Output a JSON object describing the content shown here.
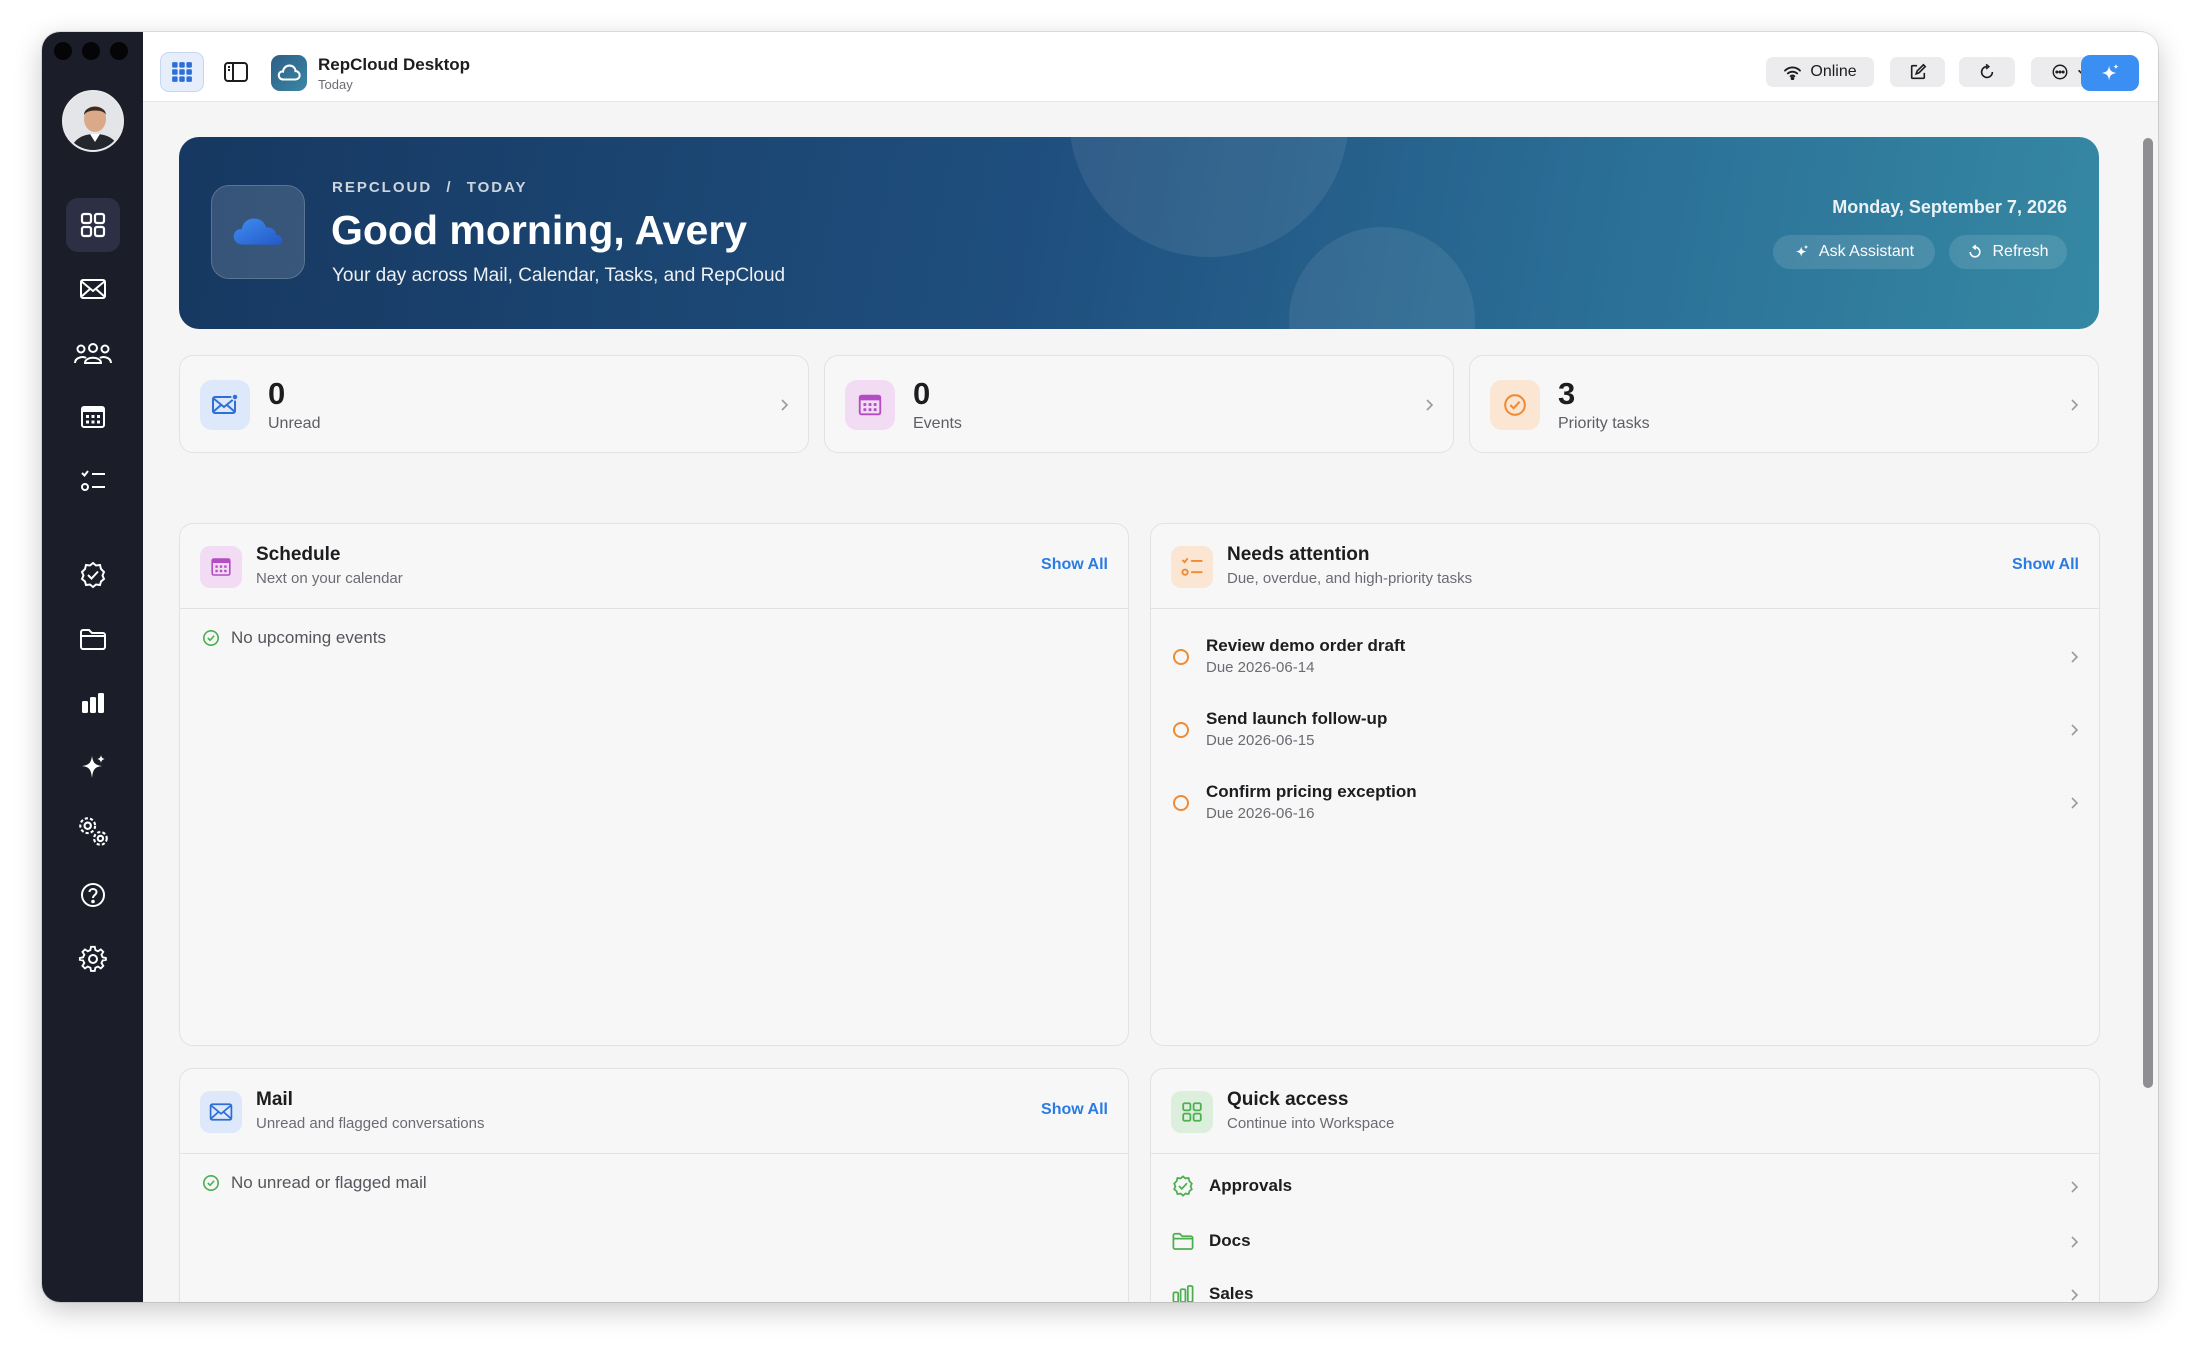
{
  "toolbar": {
    "app_title": "RepCloud Desktop",
    "app_subtitle": "Today",
    "status_label": "Online"
  },
  "hero": {
    "breadcrumb_app": "REPCLOUD",
    "breadcrumb_sep": "/",
    "breadcrumb_page": "TODAY",
    "greeting": "Good morning, Avery",
    "subtitle": "Your day across Mail, Calendar, Tasks, and RepCloud",
    "date": "Monday, September 7, 2026",
    "ask_label": "Ask Assistant",
    "refresh_label": "Refresh"
  },
  "stats": [
    {
      "value": "0",
      "label": "Unread"
    },
    {
      "value": "0",
      "label": "Events"
    },
    {
      "value": "3",
      "label": "Priority tasks"
    }
  ],
  "schedule": {
    "title": "Schedule",
    "subtitle": "Next on your calendar",
    "show_all": "Show All",
    "empty": "No upcoming events"
  },
  "attention": {
    "title": "Needs attention",
    "subtitle": "Due, overdue, and high-priority tasks",
    "show_all": "Show All",
    "tasks": [
      {
        "title": "Review demo order draft",
        "due": "Due 2026-06-14"
      },
      {
        "title": "Send launch follow-up",
        "due": "Due 2026-06-15"
      },
      {
        "title": "Confirm pricing exception",
        "due": "Due 2026-06-16"
      }
    ]
  },
  "mail": {
    "title": "Mail",
    "subtitle": "Unread and flagged conversations",
    "show_all": "Show All",
    "empty": "No unread or flagged mail"
  },
  "quick": {
    "title": "Quick access",
    "subtitle": "Continue into Workspace",
    "items": [
      {
        "label": "Approvals",
        "icon": "check-badge-icon"
      },
      {
        "label": "Docs",
        "icon": "folder-icon"
      },
      {
        "label": "Sales",
        "icon": "bar-chart-icon"
      }
    ]
  },
  "sidebar": {
    "items": [
      "dashboard-icon",
      "mail-icon",
      "people-icon",
      "calendar-icon",
      "tasks-icon",
      "approvals-icon",
      "folder-icon",
      "sales-icon",
      "sparkle-icon",
      "gears-icon",
      "help-icon",
      "settings-icon"
    ]
  },
  "colors": {
    "sidebar": "#1b1d29",
    "accent": "#2a7ce0",
    "task_ring": "#ef8a35",
    "success": "#4caf50"
  }
}
